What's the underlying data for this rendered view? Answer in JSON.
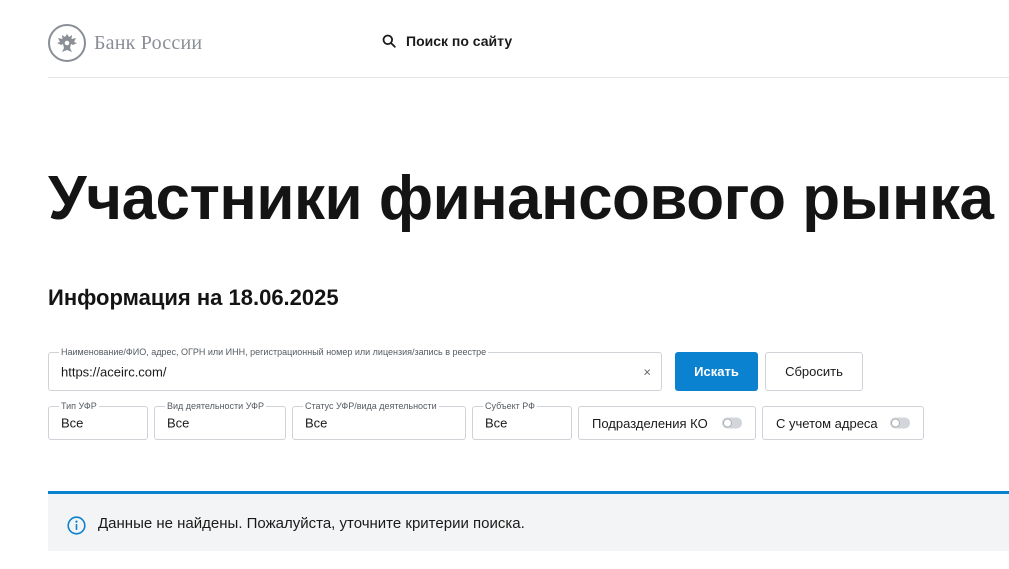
{
  "header": {
    "logo_text": "Банк России",
    "site_search_label": "Поиск по сайту"
  },
  "page": {
    "title": "Участники финансового рынка",
    "info_date": "Информация на 18.06.2025"
  },
  "search": {
    "legend": "Наименование/ФИО, адрес, ОГРН или ИНН, регистрационный номер или лицензия/запись в реестре",
    "value": "https://aceirc.com/",
    "clear_icon": "×",
    "search_button": "Искать",
    "reset_button": "Сбросить"
  },
  "filters": {
    "ufr_type": {
      "legend": "Тип УФР",
      "value": "Все"
    },
    "activity_type": {
      "legend": "Вид деятельности УФР",
      "value": "Все"
    },
    "status": {
      "legend": "Статус УФР/вида деятельности",
      "value": "Все"
    },
    "region": {
      "legend": "Субъект РФ",
      "value": "Все"
    },
    "ko_divisions": {
      "label": "Подразделения КО",
      "enabled": false
    },
    "with_address": {
      "label": "С учетом адреса",
      "enabled": false
    }
  },
  "notice": {
    "icon": "info-icon",
    "text": "Данные не найдены. Пожалуйста, уточните критерии поиска."
  },
  "colors": {
    "accent": "#0a82cf",
    "notice_background": "#f3f4f5",
    "border": "#cfd3d7",
    "logo_gray": "#8a8f96"
  }
}
